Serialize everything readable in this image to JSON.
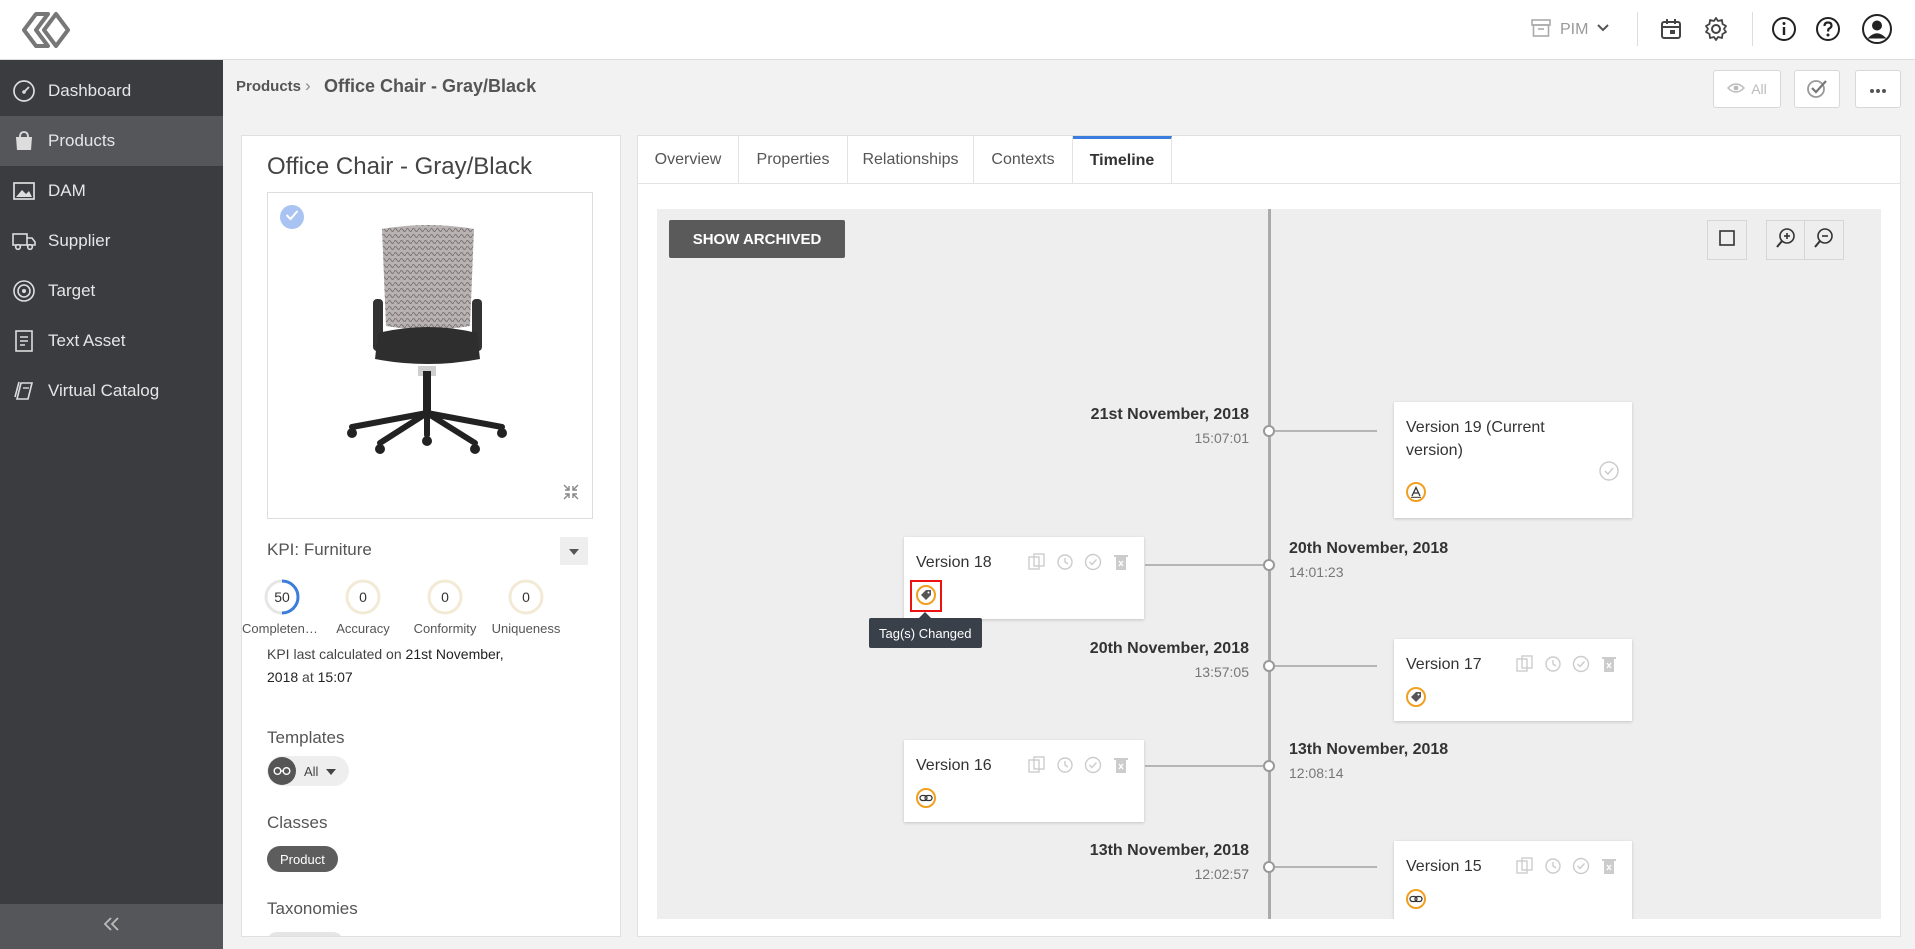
{
  "header": {
    "module_label": "PIM"
  },
  "sidebar": {
    "items": [
      {
        "label": "Dashboard",
        "icon": "dashboard-icon"
      },
      {
        "label": "Products",
        "icon": "products-icon",
        "active": true
      },
      {
        "label": "DAM",
        "icon": "image-icon"
      },
      {
        "label": "Supplier",
        "icon": "truck-icon"
      },
      {
        "label": "Target",
        "icon": "target-icon"
      },
      {
        "label": "Text Asset",
        "icon": "document-icon"
      },
      {
        "label": "Virtual Catalog",
        "icon": "catalog-icon"
      }
    ]
  },
  "breadcrumb": {
    "parent": "Products",
    "separator": "›",
    "current": "Office Chair - Gray/Black"
  },
  "toolbar": {
    "view_label": "All"
  },
  "product": {
    "title": "Office Chair - Gray/Black",
    "kpi_label": "KPI:  Furniture",
    "kpis": [
      {
        "name": "Completene...",
        "value": "50",
        "fraction": 0.5
      },
      {
        "name": "Accuracy",
        "value": "0",
        "fraction": 0
      },
      {
        "name": "Conformity",
        "value": "0",
        "fraction": 0
      },
      {
        "name": "Uniqueness",
        "value": "0",
        "fraction": 0
      }
    ],
    "kpi_note_prefix": "KPI last calculated on ",
    "kpi_note_date": "21st November, 2018",
    "kpi_note_mid": " at ",
    "kpi_note_time": "15:07",
    "templates_label": "Templates",
    "templates_value": "All",
    "classes_label": "Classes",
    "class_chip": "Product",
    "taxonomies_label": "Taxonomies"
  },
  "tabs": [
    {
      "label": "Overview"
    },
    {
      "label": "Properties"
    },
    {
      "label": "Relationships"
    },
    {
      "label": "Contexts"
    },
    {
      "label": "Timeline",
      "active": true
    }
  ],
  "timeline": {
    "show_archived_label": "SHOW ARCHIVED",
    "tooltip": "Tag(s) Changed",
    "entries": [
      {
        "date": "21st November, 2018",
        "time": "15:07:01",
        "version": "Version 19 (Current version)",
        "change": "attribute-icon"
      },
      {
        "date": "20th November, 2018",
        "time": "14:01:23",
        "version": "Version 18",
        "change": "tag-icon"
      },
      {
        "date": "20th November, 2018",
        "time": "13:57:05",
        "version": "Version 17",
        "change": "tag-icon"
      },
      {
        "date": "13th November, 2018",
        "time": "12:08:14",
        "version": "Version 16",
        "change": "relationship-icon"
      },
      {
        "date": "13th November, 2018",
        "time": "12:02:57",
        "version": "Version 15",
        "change": "relationship-icon"
      }
    ]
  },
  "colors": {
    "sidebar_bg": "#3a3c40",
    "sidebar_active": "#54565a",
    "tab_accent": "#3b7ddd",
    "change_badge": "#f0a020",
    "highlight": "#e11111"
  }
}
